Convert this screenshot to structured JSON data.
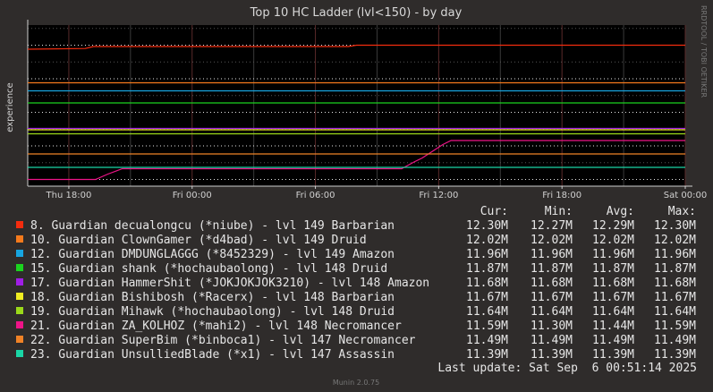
{
  "chart_data": {
    "type": "line",
    "title": "Top 10 HC Ladder (lvl<150) - by day",
    "ylabel": "experience",
    "side_label": "RRDTOOL / TOBI OETIKER",
    "x_ticks": [
      "Thu 18:00",
      "Fri 00:00",
      "Fri 06:00",
      "Fri 12:00",
      "Fri 18:00",
      "Sat 00:00"
    ],
    "ylim": [
      11.25,
      12.45
    ],
    "y_unit": "M",
    "x_range_hours": [
      -2,
      30
    ],
    "columns": [
      "Cur:",
      "Min:",
      "Avg:",
      "Max:"
    ],
    "series": [
      {
        "name": "8. Guardian decualongcu (*niube) - lvl 149 Barbarian",
        "color": "#f42c0e",
        "cur": "12.30M",
        "min": "12.27M",
        "avg": "12.29M",
        "max": "12.30M",
        "points": [
          [
            -2,
            12.27
          ],
          [
            0.8,
            12.275
          ],
          [
            1.2,
            12.29
          ],
          [
            13.6,
            12.29
          ],
          [
            14.0,
            12.3
          ],
          [
            30,
            12.3
          ]
        ]
      },
      {
        "name": "10. Guardian ClownGamer (*d4bad) - lvl 149 Druid",
        "color": "#f57a1c",
        "cur": "12.02M",
        "min": "12.02M",
        "avg": "12.02M",
        "max": "12.02M",
        "points": [
          [
            -2,
            12.02
          ],
          [
            30,
            12.02
          ]
        ]
      },
      {
        "name": "12. Guardian DMDUNGLAGGG (*8452329) - lvl 149 Amazon",
        "color": "#17a5e0",
        "cur": "11.96M",
        "min": "11.96M",
        "avg": "11.96M",
        "max": "11.96M",
        "points": [
          [
            -2,
            11.96
          ],
          [
            30,
            11.96
          ]
        ]
      },
      {
        "name": "15. Guardian shank (*hochaubaolong) - lvl 148 Druid",
        "color": "#1bd31f",
        "cur": "11.87M",
        "min": "11.87M",
        "avg": "11.87M",
        "max": "11.87M",
        "points": [
          [
            -2,
            11.87
          ],
          [
            30,
            11.87
          ]
        ]
      },
      {
        "name": "17. Guardian HammerShit (*JOKJOKJOK3210) - lvl 148 Amazon",
        "color": "#a01ee6",
        "cur": "11.68M",
        "min": "11.68M",
        "avg": "11.68M",
        "max": "11.68M",
        "points": [
          [
            -2,
            11.68
          ],
          [
            30,
            11.68
          ]
        ]
      },
      {
        "name": "18. Guardian Bishibosh (*Racerx) - lvl 148 Barbarian",
        "color": "#f0ed22",
        "cur": "11.67M",
        "min": "11.67M",
        "avg": "11.67M",
        "max": "11.67M",
        "points": [
          [
            -2,
            11.67
          ],
          [
            30,
            11.67
          ]
        ]
      },
      {
        "name": "19. Guardian Mihawk (*hochaubaolong) - lvl 148 Druid",
        "color": "#9bd91a",
        "cur": "11.64M",
        "min": "11.64M",
        "avg": "11.64M",
        "max": "11.64M",
        "points": [
          [
            -2,
            11.64
          ],
          [
            30,
            11.64
          ]
        ]
      },
      {
        "name": "21. Guardian ZA_KOLHOZ (*mahi2) - lvl 148 Necromancer",
        "color": "#ee1488",
        "cur": "11.59M",
        "min": "11.30M",
        "avg": "11.44M",
        "max": "11.59M",
        "points": [
          [
            -2,
            11.3
          ],
          [
            1.3,
            11.3
          ],
          [
            1.9,
            11.34
          ],
          [
            2.6,
            11.38
          ],
          [
            16.2,
            11.38
          ],
          [
            16.8,
            11.43
          ],
          [
            17.2,
            11.46
          ],
          [
            17.9,
            11.53
          ],
          [
            18.2,
            11.56
          ],
          [
            18.6,
            11.59
          ],
          [
            30,
            11.59
          ]
        ]
      },
      {
        "name": "22. Guardian SuperBim (*binboca1) - lvl 147 Necromancer",
        "color": "#f08226",
        "cur": "11.49M",
        "min": "11.49M",
        "avg": "11.49M",
        "max": "11.49M",
        "points": [
          [
            -2,
            11.49
          ],
          [
            30,
            11.49
          ]
        ]
      },
      {
        "name": "23. Guardian UnsulliedBlade (*x1) - lvl 147 Assassin",
        "color": "#1ad6a6",
        "cur": "11.39M",
        "min": "11.39M",
        "avg": "11.39M",
        "max": "11.39M",
        "points": [
          [
            -2,
            11.39
          ],
          [
            30,
            11.39
          ]
        ]
      }
    ],
    "last_update": "Last update: Sat Sep  6 00:51:14 2025",
    "footer": "Munin 2.0.75"
  }
}
